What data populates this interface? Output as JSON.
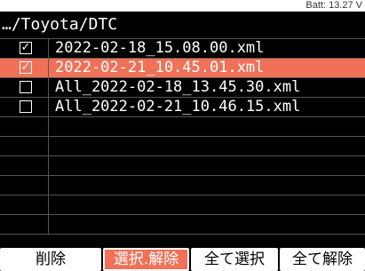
{
  "status": {
    "battery": "Batt: 13.27 V"
  },
  "path": "…/Toyota/DTC",
  "files": [
    {
      "name": "2022-02-18_15.08.00.xml",
      "checked": true,
      "selected": false
    },
    {
      "name": "2022-02-21_10.45.01.xml",
      "checked": true,
      "selected": true
    },
    {
      "name": "All_2022-02-18_13.45.30.xml",
      "checked": false,
      "selected": false
    },
    {
      "name": "All_2022-02-21_10.46.15.xml",
      "checked": false,
      "selected": false
    }
  ],
  "empty_rows": 6,
  "buttons": {
    "delete": "削除",
    "toggle_select": "選択.解除",
    "select_all": "全て選択",
    "deselect_all": "全て解除"
  },
  "colors": {
    "accent": "#f07158",
    "background": "#000000",
    "grid": "#555555"
  },
  "icons": {
    "checked": "checkbox-checked-icon",
    "unchecked": "checkbox-empty-icon"
  }
}
